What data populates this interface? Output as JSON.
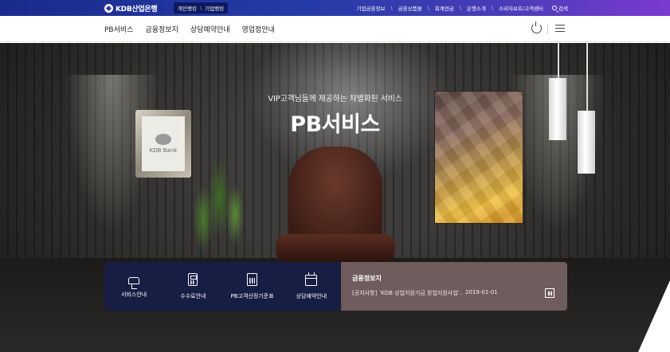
{
  "header": {
    "logo_text": "KDB산업은행",
    "bank_tabs": [
      "개인뱅킹",
      "기업뱅킹"
    ],
    "util_links": [
      "기업금융정보",
      "금융상품몰",
      "회계연금",
      "은행소개",
      "소비자보호/고객센터"
    ],
    "search_label": "검색"
  },
  "nav": {
    "items": [
      "PB서비스",
      "금융정보지",
      "상담예약안내",
      "영업점안내"
    ]
  },
  "hero": {
    "subtitle": "VIP고객님들께 제공하는 차별화된 서비스",
    "title": "PB서비스",
    "frame_text": "KDB Bank"
  },
  "quick_menu": [
    {
      "label": "서비스안내",
      "icon": "hand-service-icon"
    },
    {
      "label": "수수료안내",
      "icon": "calculator-icon"
    },
    {
      "label": "PB고객산정기준표",
      "icon": "document-chart-icon"
    },
    {
      "label": "상담예약안내",
      "icon": "calendar-icon"
    }
  ],
  "notice": {
    "title": "금융정보지",
    "tag": "[공지사항]",
    "text": "'KDB 상업지원기금 창업지원사업'..",
    "date": "2019-01-01"
  },
  "colors": {
    "topbar_start": "#1b2a8c",
    "topbar_end": "#7b3ad0",
    "quick_bg": "#161e46",
    "notice_bg": "#735f5f"
  }
}
